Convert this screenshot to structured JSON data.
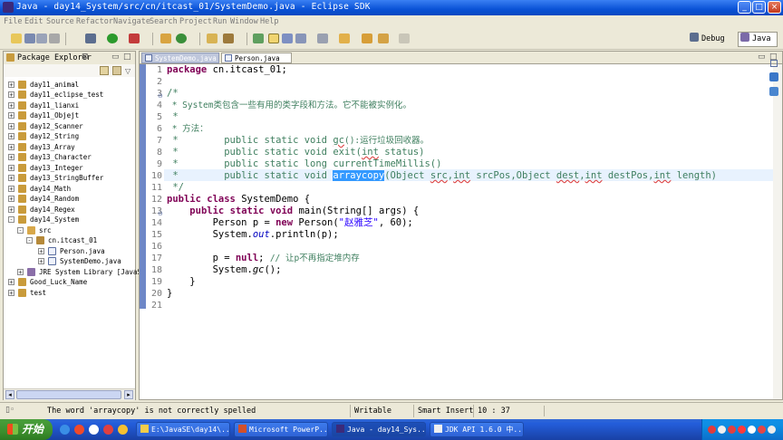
{
  "window": {
    "title": "Java - day14_System/src/cn/itcast_01/SystemDemo.java - Eclipse SDK",
    "buttons": {
      "minimize": "_",
      "maximize": "□",
      "close": "×"
    }
  },
  "menu": [
    "File",
    "Edit",
    "Source",
    "Refactor",
    "Navigate",
    "Search",
    "Project",
    "Run",
    "Window",
    "Help"
  ],
  "perspectives": {
    "debug": "Debug",
    "java": "Java"
  },
  "package_explorer": {
    "title": "Package Explorer",
    "items": [
      {
        "label": "day11_animal",
        "expander": "+"
      },
      {
        "label": "day11_eclipse_test",
        "expander": "+"
      },
      {
        "label": "day11_lianxi",
        "expander": "+"
      },
      {
        "label": "day11_Objejt",
        "expander": "+"
      },
      {
        "label": "day12_Scanner",
        "expander": "+"
      },
      {
        "label": "day12_String",
        "expander": "+"
      },
      {
        "label": "day13_Array",
        "expander": "+"
      },
      {
        "label": "day13_Character",
        "expander": "+"
      },
      {
        "label": "day13_Integer",
        "expander": "+"
      },
      {
        "label": "day13_StringBuffer",
        "expander": "+"
      },
      {
        "label": "day14_Math",
        "expander": "+"
      },
      {
        "label": "day14_Random",
        "expander": "+"
      },
      {
        "label": "day14_Regex",
        "expander": "+"
      },
      {
        "label": "day14_System",
        "expander": "-"
      },
      {
        "label": "src",
        "expander": "-"
      },
      {
        "label": "cn.itcast_01",
        "expander": "-"
      },
      {
        "label": "Person.java",
        "expander": "+"
      },
      {
        "label": "SystemDemo.java",
        "expander": "+"
      },
      {
        "label": "JRE System Library [JavaS",
        "expander": "+"
      },
      {
        "label": "Good_Luck_Name",
        "expander": "+"
      },
      {
        "label": "test",
        "expander": "+"
      }
    ]
  },
  "editor": {
    "tabs": [
      {
        "label": "SystemDemo.java",
        "active": true
      },
      {
        "label": "Person.java",
        "active": false
      }
    ],
    "line_numbers": [
      "1",
      "2",
      "3",
      "4",
      "5",
      "6",
      "7",
      "8",
      "9",
      "10",
      "11",
      "12",
      "13",
      "14",
      "15",
      "16",
      "17",
      "18",
      "19",
      "20",
      "21"
    ],
    "lines": [
      "package cn.itcast_01;",
      "",
      "/*",
      " * System类包含一些有用的类字段和方法。它不能被实例化。",
      " *",
      " * 方法：",
      " *        public static void gc():运行垃圾回收器。",
      " *        public static void exit(int status)",
      " *        public static long currentTimeMillis()",
      " *        public static void arraycopy(Object src,int srcPos,Object dest,int destPos,int length)",
      " */",
      "public class SystemDemo {",
      "    public static void main(String[] args) {",
      "        Person p = new Person(\"赵雅芝\", 60);",
      "        System.out.println(p);",
      "",
      "        p = null; // 让p不再指定堆内存",
      "        System.gc();",
      "    }",
      "}",
      ""
    ],
    "tokens": {
      "l1_kw": "package",
      "l1_rest": " cn.itcast_01;",
      "l3": "/*",
      "l4": " * System类包含一些有用的类字段和方法。它不能被实例化。",
      "l5": " *",
      "l6": " * 方法：",
      "l7a": " *        public static void ",
      "l7b": "gc",
      "l7c": "():运行垃圾回收器。",
      "l8a": " *        public static void ",
      "l8b": "exit",
      "l8c": "(",
      "l8d": "int",
      "l8e": " status)",
      "l9a": " *        public static long ",
      "l9b": "currentTimeMillis",
      "l9c": "()",
      "l10a": " *        public static void ",
      "l10b": "arraycopy",
      "l10c": "(Object ",
      "l10d": "src",
      "l10e": ",",
      "l10f": "int",
      "l10g": " ",
      "l10h": "srcPos",
      "l10i": ",Object ",
      "l10j": "dest",
      "l10k": ",",
      "l10l": "int",
      "l10m": " ",
      "l10n": "destPos",
      "l10o": ",",
      "l10p": "int",
      "l10q": " length)",
      "l11": " */",
      "l12_kw1": "public",
      "l12_kw2": "class",
      "l12_rest": " SystemDemo {",
      "l13_ind": "    ",
      "l13_kw1": "public",
      "l13_kw2": "static",
      "l13_kw3": "void",
      "l13_rest": " main(String[] args) {",
      "l14a": "        Person p = ",
      "l14_kw": "new",
      "l14b": " Person(",
      "l14_str": "\"赵雅芝\"",
      "l14c": ", 60);",
      "l15a": "        System.",
      "l15_fld": "out",
      "l15b": ".println(p);",
      "l17a": "        p = ",
      "l17_kw": "null",
      "l17b": "; ",
      "l17_cm": "// 让p不再指定堆内存",
      "l18a": "        System.",
      "l18_itl": "gc",
      "l18b": "();",
      "l19": "    }",
      "l20": "}"
    }
  },
  "status_bar": {
    "message": "The word 'arraycopy' is not correctly spelled",
    "mode": "Writable",
    "insert": "Smart Insert",
    "position": "10 : 37"
  },
  "taskbar": {
    "start": "开始",
    "tasks": [
      {
        "label": "E:\\JavaSE\\day14\\...",
        "active": false
      },
      {
        "label": "Microsoft PowerP...",
        "active": false
      },
      {
        "label": "Java - day14_Sys...",
        "active": true
      },
      {
        "label": "JDK API 1.6.0 中...",
        "active": false
      }
    ]
  },
  "colors": {
    "keyword": "#7f0055",
    "comment": "#3f7f5f",
    "string": "#2a00ff",
    "field": "#0000c0",
    "selection": "#3399ff",
    "titlebar": "#0a52d6"
  }
}
